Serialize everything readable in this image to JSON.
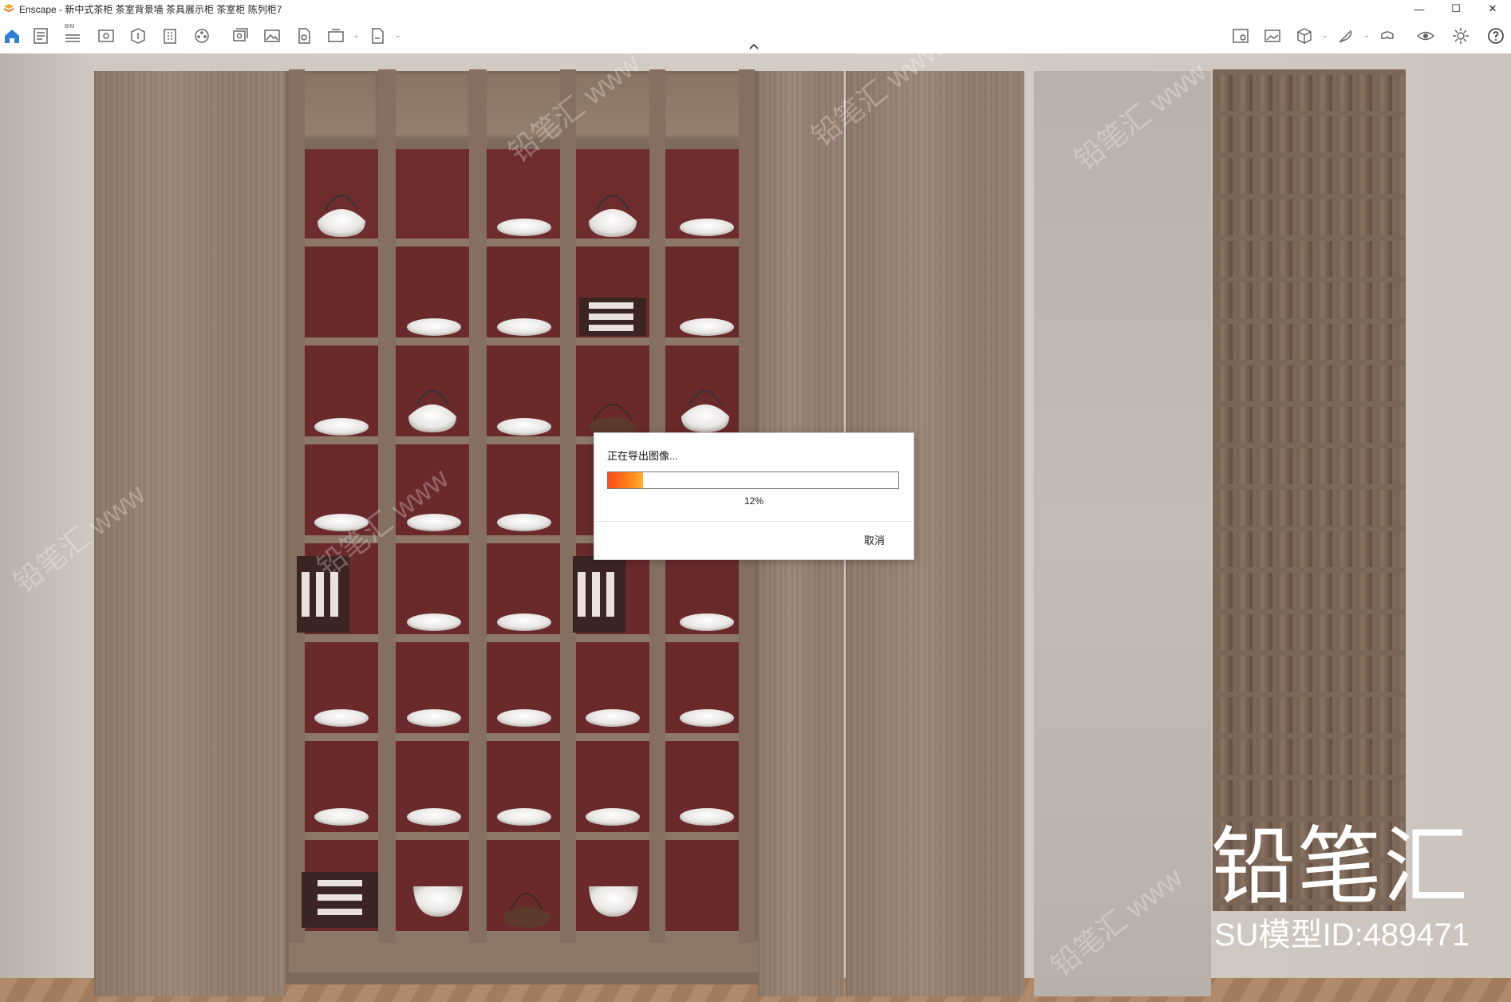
{
  "window": {
    "app_name": "Enscape",
    "title": "Enscape - 新中式茶柜 茶室背景墙 茶具展示柜 茶室柜 陈列柜7",
    "controls": {
      "minimize": "—",
      "maximize": "☐",
      "close": "✕"
    }
  },
  "toolbar": {
    "bim_label": "BIM",
    "icons_left": [
      "home-icon",
      "document-icon",
      "bim-icon",
      "view-icon",
      "asset-icon",
      "building-icon",
      "film-reel-icon",
      "batch-render-icon",
      "image-icon",
      "panorama-icon",
      "view-360-icon",
      "export-icon"
    ],
    "icons_right": [
      "render-settings-icon",
      "screenshot-icon",
      "cube-icon",
      "feather-icon",
      "vr-headset-icon",
      "eye-icon",
      "gear-icon",
      "help-icon"
    ]
  },
  "dialog": {
    "title": "正在导出图像...",
    "progress_percent": 12,
    "progress_label": "12%",
    "cancel_label": "取消"
  },
  "watermark": {
    "logo_text": "铅笔汇",
    "model_id_text": "SU模型ID:489471"
  },
  "colors": {
    "accent_home": "#2f7fd6",
    "progress_start": "#ff4a1a",
    "progress_end": "#ffb02a",
    "cabinet_back": "#6e2c2e"
  }
}
